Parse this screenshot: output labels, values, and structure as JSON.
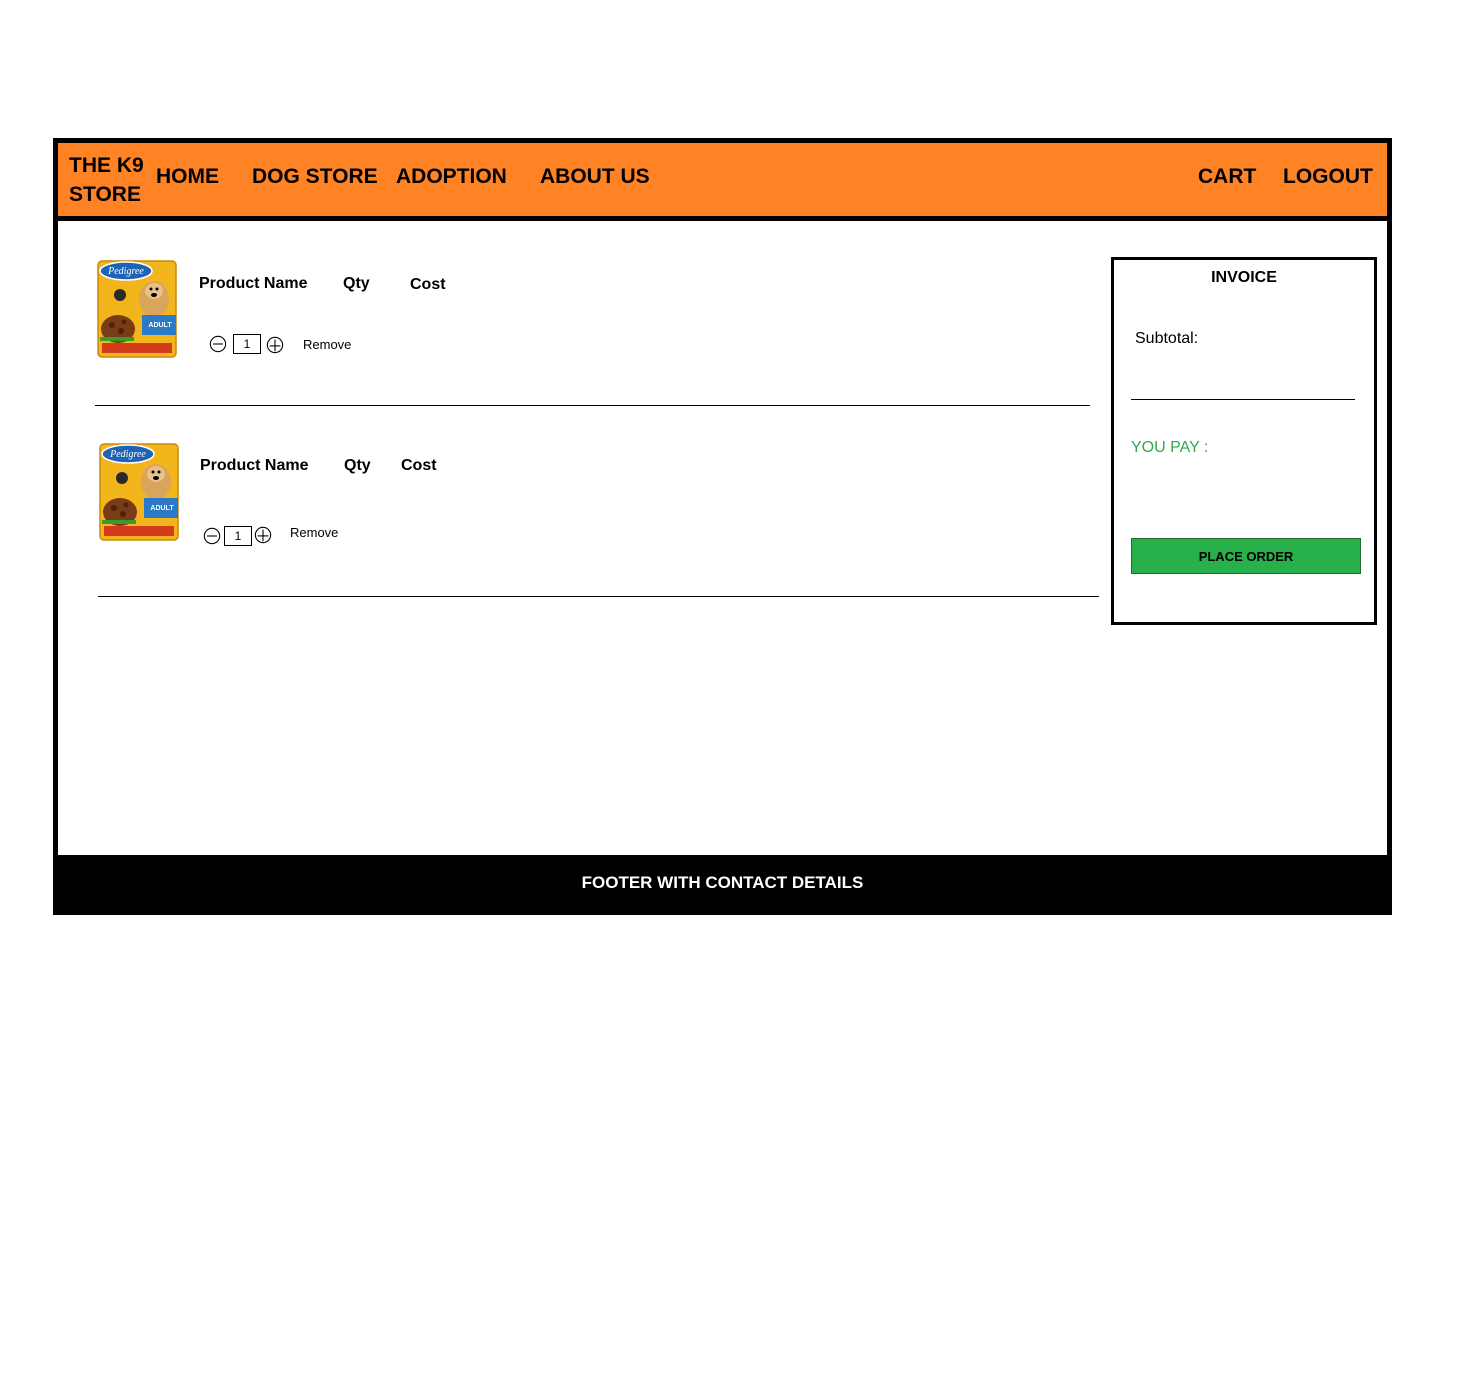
{
  "colors": {
    "nav_bg": "#ff8225",
    "footer_bg": "#000000",
    "accent_green": "#28b04b",
    "you_pay_text": "#2eaa4e"
  },
  "brand": {
    "line1": "THE K9",
    "line2": "STORE"
  },
  "nav": {
    "home": "HOME",
    "dog_store": "DOG STORE",
    "adoption": "ADOPTION",
    "about_us": "ABOUT US",
    "cart": "CART",
    "logout": "LOGOUT"
  },
  "cart_items": [
    {
      "image_label": "Pedigree",
      "image_badge": "ADULT",
      "product_name": "Product Name",
      "qty_label": "Qty",
      "cost_label": "Cost",
      "qty": "1",
      "remove": "Remove"
    },
    {
      "image_label": "Pedigree",
      "image_badge": "ADULT",
      "product_name": "Product Name",
      "qty_label": "Qty",
      "cost_label": "Cost",
      "qty": "1",
      "remove": "Remove"
    }
  ],
  "invoice": {
    "title": "INVOICE",
    "subtotal_label": "Subtotal:",
    "you_pay_label": "YOU PAY :",
    "place_order": "PLACE ORDER"
  },
  "footer": {
    "text": "FOOTER WITH CONTACT DETAILS"
  }
}
